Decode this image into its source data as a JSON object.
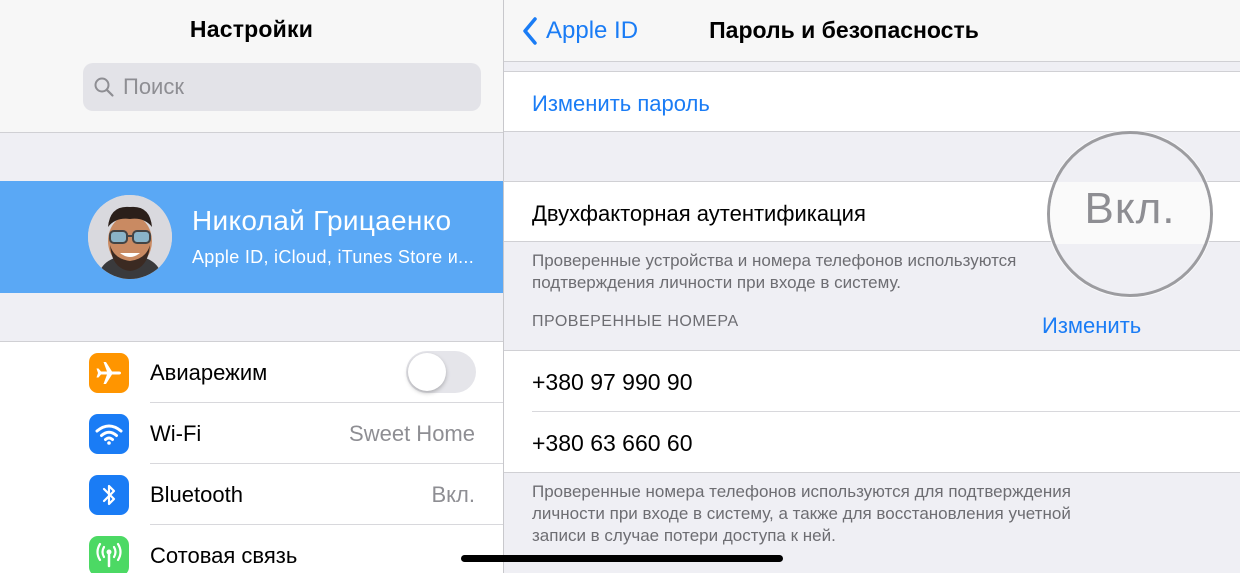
{
  "settings_pane": {
    "title": "Настройки",
    "search": {
      "placeholder": "Поиск"
    },
    "profile": {
      "name": "Николай Грицаенко",
      "subtitle": "Apple ID, iCloud, iTunes Store и..."
    },
    "rows": [
      {
        "label": "Авиарежим",
        "icon": "airplane-icon",
        "icon_color": "#ff9500",
        "toggle_on": false
      },
      {
        "label": "Wi-Fi",
        "icon": "wifi-icon",
        "icon_color": "#1a7cf5",
        "value": "Sweet Home"
      },
      {
        "label": "Bluetooth",
        "icon": "bluetooth-icon",
        "icon_color": "#1a7cf5",
        "value": "Вкл."
      },
      {
        "label": "Сотовая связь",
        "icon": "antenna-icon",
        "icon_color": "#4cd964"
      }
    ]
  },
  "detail_pane": {
    "back_label": "Apple ID",
    "title": "Пароль и безопасность",
    "change_password": "Изменить пароль",
    "two_factor": {
      "label": "Двухфакторная аутентификация",
      "status": "Вкл.",
      "footnote_line1": "Проверенные устройства и номера телефонов используются",
      "footnote_line2": "подтверждения личности при входе в систему."
    },
    "verified_numbers": {
      "header": "ПРОВЕРЕННЫЕ НОМЕРА",
      "edit_label": "Изменить",
      "numbers": [
        "+380 97 990 90",
        "+380 63 660 60"
      ],
      "footnote_lines": [
        "Проверенные номера телефонов используются для подтверждения",
        "личности при входе в систему, а также для восстановления учетной",
        "записи в случае потери доступа к ней."
      ]
    }
  },
  "colors": {
    "accent": "#1a7cf5",
    "selected_row": "#5aa8f5",
    "group_background": "#efeff4"
  }
}
